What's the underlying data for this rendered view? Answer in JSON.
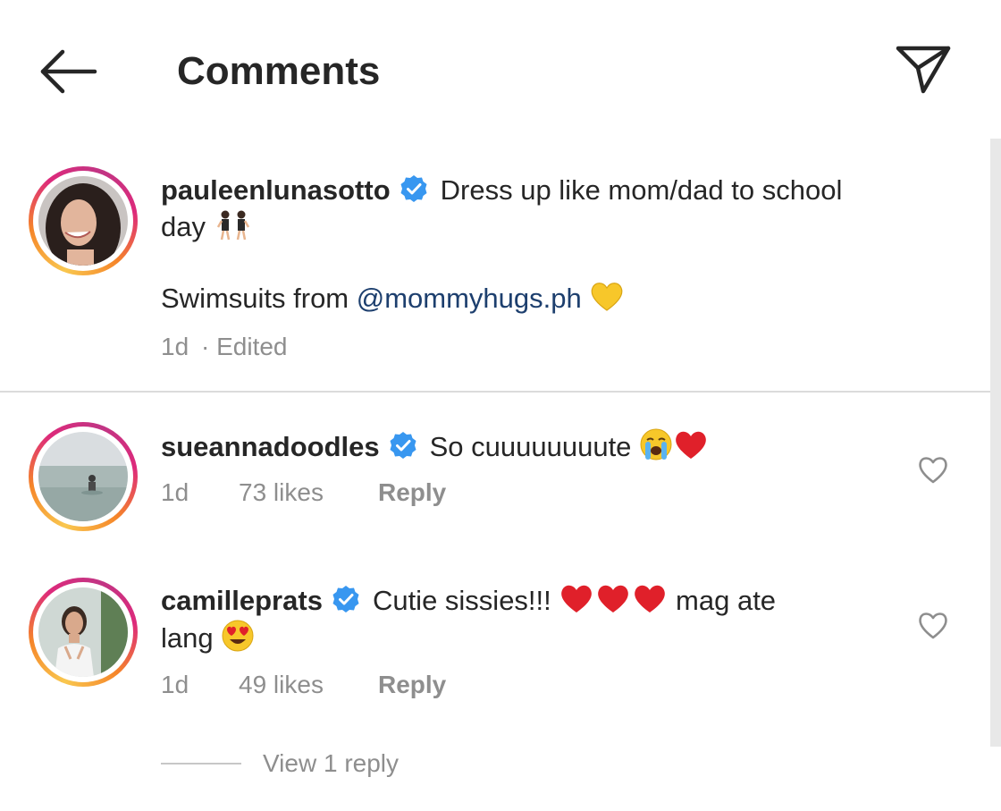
{
  "header": {
    "title": "Comments"
  },
  "post": {
    "username": "pauleenlunasotto",
    "caption_line1": "Dress up like mom/dad to school",
    "caption_line2": "day",
    "swim_prefix": "Swimsuits from ",
    "mention": "@mommyhugs.ph",
    "time": "1d",
    "edited": "· Edited"
  },
  "comments": [
    {
      "username": "sueannadoodles",
      "text": "So cuuuuuuuute",
      "time": "1d",
      "likes": "73 likes",
      "reply": "Reply"
    },
    {
      "username": "camilleprats",
      "text": "Cutie sissies!!!",
      "text_after": "mag ate",
      "text_line2": "lang",
      "time": "1d",
      "likes": "49 likes",
      "reply": "Reply"
    }
  ],
  "view_replies": "View 1 reply",
  "colors": {
    "verified": "#3897f0",
    "mention": "#1d3f6e",
    "meta": "#8e8e8e",
    "heart_red": "#e0202a",
    "yellow_heart": "#f7c72a"
  },
  "icons": {
    "back": "arrow-left-icon",
    "send": "paper-plane-icon",
    "verified": "verified-badge-icon",
    "like": "heart-outline-icon"
  }
}
